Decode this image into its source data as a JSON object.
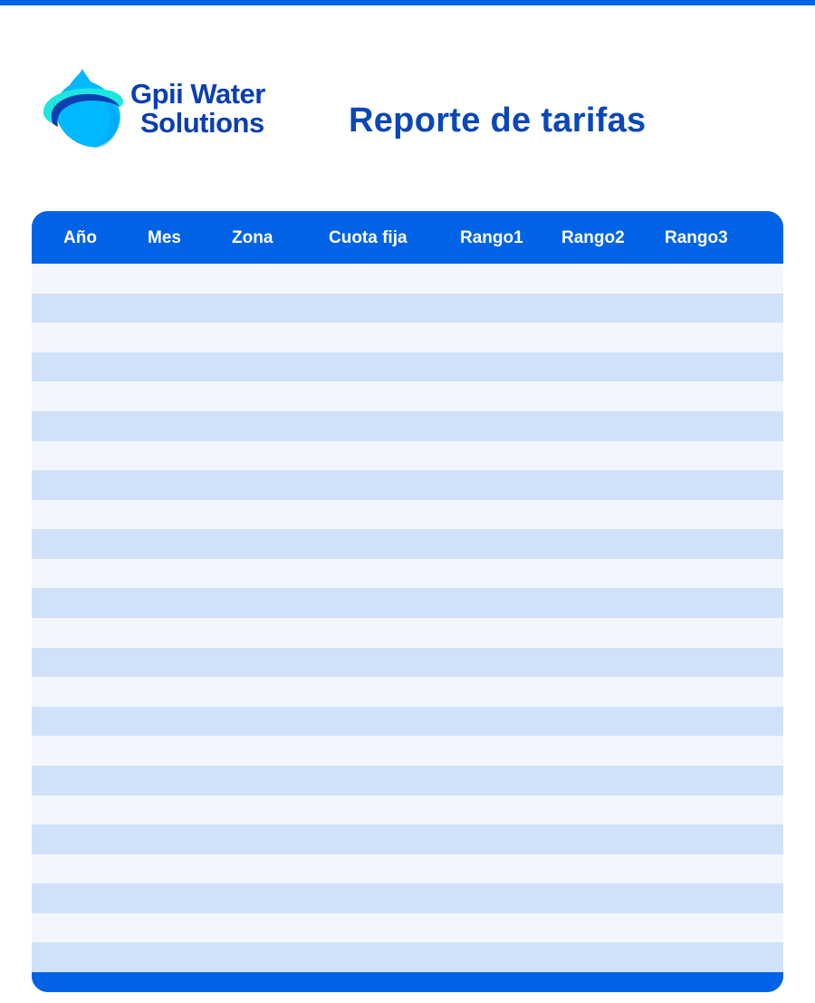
{
  "brand": {
    "name_line1": "Gpii Water",
    "name_line2": "Solutions",
    "logo_icon": "water-drop-icon",
    "colors": {
      "primary": "#0063e5",
      "dark_blue": "#0a3fb0",
      "cyan": "#1de5e0",
      "light_blue": "#00b8ff"
    }
  },
  "report": {
    "title": "Reporte de tarifas"
  },
  "table": {
    "columns": [
      "Año",
      "Mes",
      "Zona",
      "Cuota fija",
      "Rango1",
      "Rango2",
      "Rango3"
    ],
    "row_count": 24,
    "rows": [],
    "row_colors": {
      "light": "#f2f7fd",
      "dark": "#d1e1f9"
    }
  }
}
